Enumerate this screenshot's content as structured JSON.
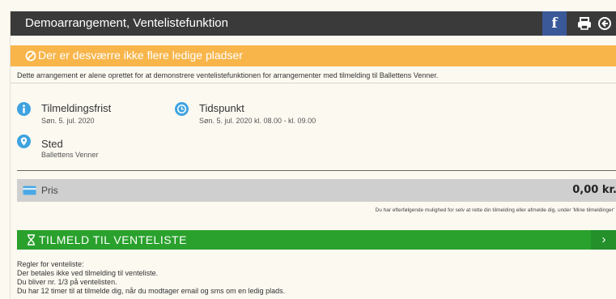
{
  "header": {
    "title": "Demoarrangement, Ventelistefunktion",
    "facebook_label": "f"
  },
  "alert": {
    "text": "Der er desværre ikke flere ledige pladser",
    "color": "#f8b54a"
  },
  "description": "Dette arrangement er alene oprettet for at demonstrere ventelistefunktionen for arrangementer med tilmelding til Ballettens Venner.",
  "info": {
    "deadline": {
      "label": "Tilmeldingsfrist",
      "value": "Søn. 5. jul. 2020"
    },
    "time": {
      "label": "Tidspunkt",
      "value": "Søn. 5. jul. 2020 kl. 08.00 - kl. 09.00"
    },
    "place": {
      "label": "Sted",
      "value": "Ballettens Venner"
    }
  },
  "price": {
    "label": "Pris",
    "value": "0,00 kr."
  },
  "note": "Du har efterfølgende mulighed for selv at rette din tilmelding eller afmelde dig, under 'Mine tilmeldinger'",
  "signup": {
    "label": "TILMELD TIL VENTELISTE",
    "arrow": "›",
    "color": "#2aa12d"
  },
  "rules": {
    "heading": "Regler for venteliste:",
    "lines": [
      "Der betales ikke ved tilmelding til venteliste.",
      "Du bliver nr. 1/3 på ventelisten.",
      "Du har 12 timer til at tilmelde dig, når du modtager email og sms om en ledig plads."
    ]
  },
  "icons": {
    "facebook": "facebook-icon",
    "print": "print-icon",
    "close": "close-circle-icon",
    "ban": "ban-icon",
    "info": "info-icon",
    "clock": "clock-icon",
    "location": "location-pin-icon",
    "card": "credit-card-icon",
    "hourglass": "hourglass-icon"
  }
}
